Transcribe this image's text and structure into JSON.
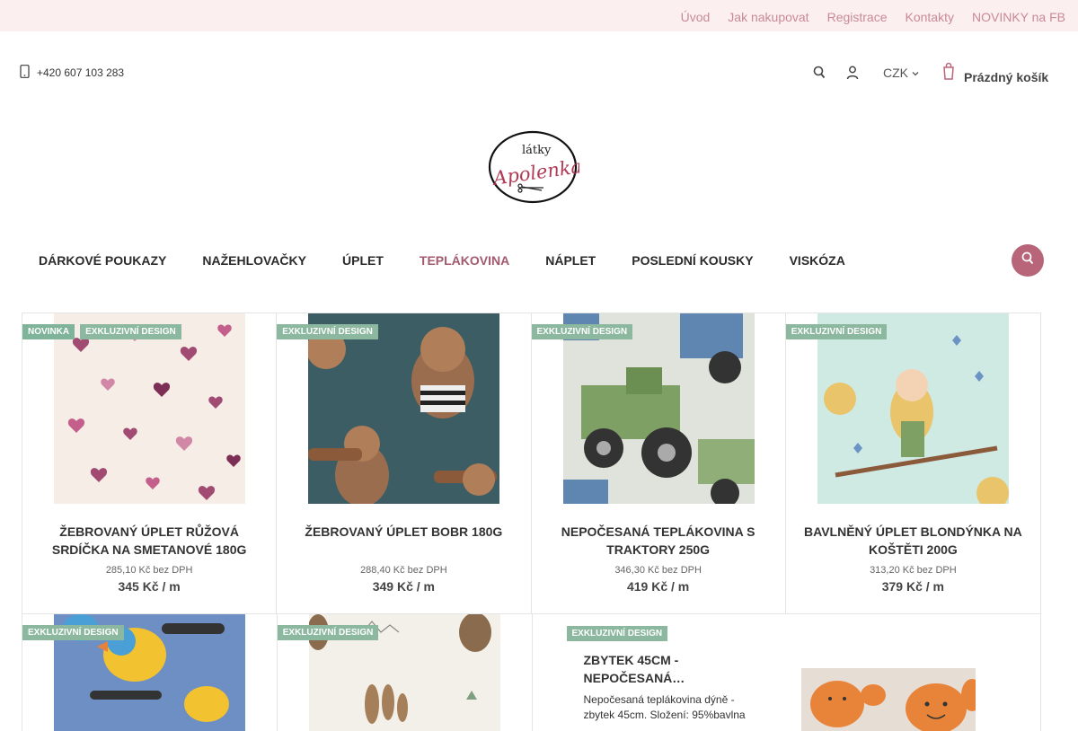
{
  "topbar": {
    "links": [
      "Úvod",
      "Jak nakupovat",
      "Registrace",
      "Kontakty",
      "NOVINKY na FB"
    ]
  },
  "header": {
    "phone": "+420 607 103 283",
    "currency": "CZK",
    "cart_label": "Prázdný košík"
  },
  "logo": {
    "top_text": "látky",
    "brand_text": "Apolenka"
  },
  "nav": {
    "items": [
      "DÁRKOVÉ POUKAZY",
      "NAŽEHLOVAČKY",
      "ÚPLET",
      "TEPLÁKOVINA",
      "NÁPLET",
      "POSLEDNÍ KOUSKY",
      "VISKÓZA"
    ],
    "active": "TEPLÁKOVINA"
  },
  "products": [
    {
      "badges": [
        "NOVINKA",
        "EXKLUZIVNÍ DESIGN"
      ],
      "title": "ŽEBROVANÝ ÚPLET RŮŽOVÁ SRDÍČKA NA SMETANOVÉ 180G",
      "net": "285,10 Kč bez DPH",
      "price": "345 Kč / m"
    },
    {
      "badges": [
        "EXKLUZIVNÍ DESIGN"
      ],
      "title": "ŽEBROVANÝ ÚPLET BOBR 180G",
      "net": "288,40 Kč bez DPH",
      "price": "349 Kč / m"
    },
    {
      "badges": [
        "EXKLUZIVNÍ DESIGN"
      ],
      "title": "NEPOČESANÁ TEPLÁKOVINA S TRAKTORY 250G",
      "net": "346,30 Kč bez DPH",
      "price": "419 Kč / m"
    },
    {
      "badges": [
        "EXKLUZIVNÍ DESIGN"
      ],
      "title": "BAVLNĚNÝ ÚPLET BLONDÝNKA NA KOŠTĚTI 200G",
      "net": "313,20 Kč bez DPH",
      "price": "379 Kč / m"
    }
  ],
  "row2": {
    "c1_badge": "EXKLUZIVNÍ DESIGN",
    "c2_badge": "EXKLUZIVNÍ DESIGN",
    "featured": {
      "badge": "EXKLUZIVNÍ DESIGN",
      "title": "ZBYTEK 45CM - NEPOČESANÁ…",
      "desc": "Nepočesaná teplákovina dýně - zbytek 45cm. Složení: 95%bavlna"
    }
  }
}
